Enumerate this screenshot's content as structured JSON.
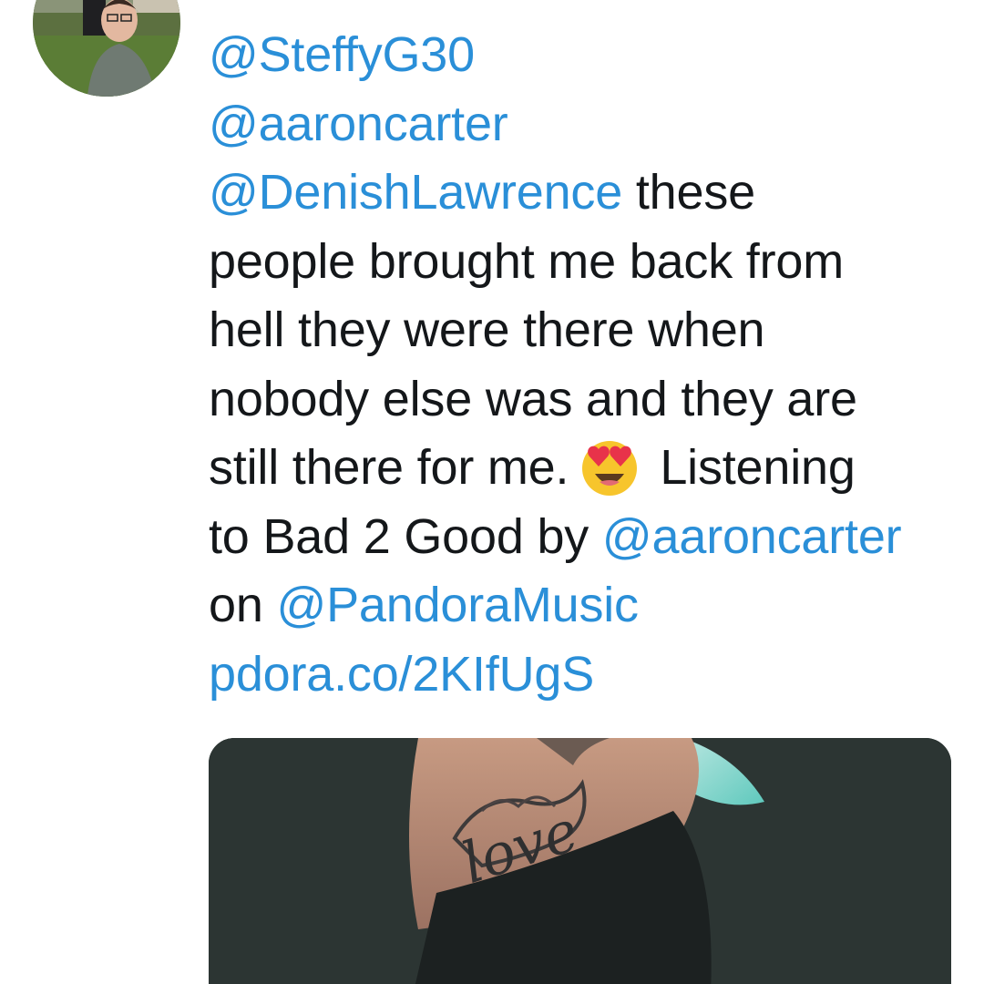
{
  "tweet": {
    "lines": [
      {
        "mention": "@SteffyG30"
      },
      {
        "mention": "@aaroncarter"
      },
      {
        "mention": "@DenishLawrence",
        "text": " these"
      },
      {
        "text": "people brought me back from"
      },
      {
        "text": "hell they were there when"
      },
      {
        "text": "nobody else was and they are"
      },
      {
        "text": "still there for me.",
        "emoji": "heart-eyes-emoji",
        "text2": "Listening"
      },
      {
        "text": "to Bad 2 Good by ",
        "mention": "@aaroncarter"
      },
      {
        "text": "on ",
        "mention": "@PandoraMusic"
      },
      {
        "link": "pdora.co/2KIfUgS"
      }
    ]
  },
  "colors": {
    "mention": "#2a8fd8",
    "text": "#14171a",
    "emoji_face": "#f7c52c",
    "emoji_heart": "#e8334a"
  },
  "media": {
    "tattoo_text": "love",
    "description_icon": "photo"
  }
}
